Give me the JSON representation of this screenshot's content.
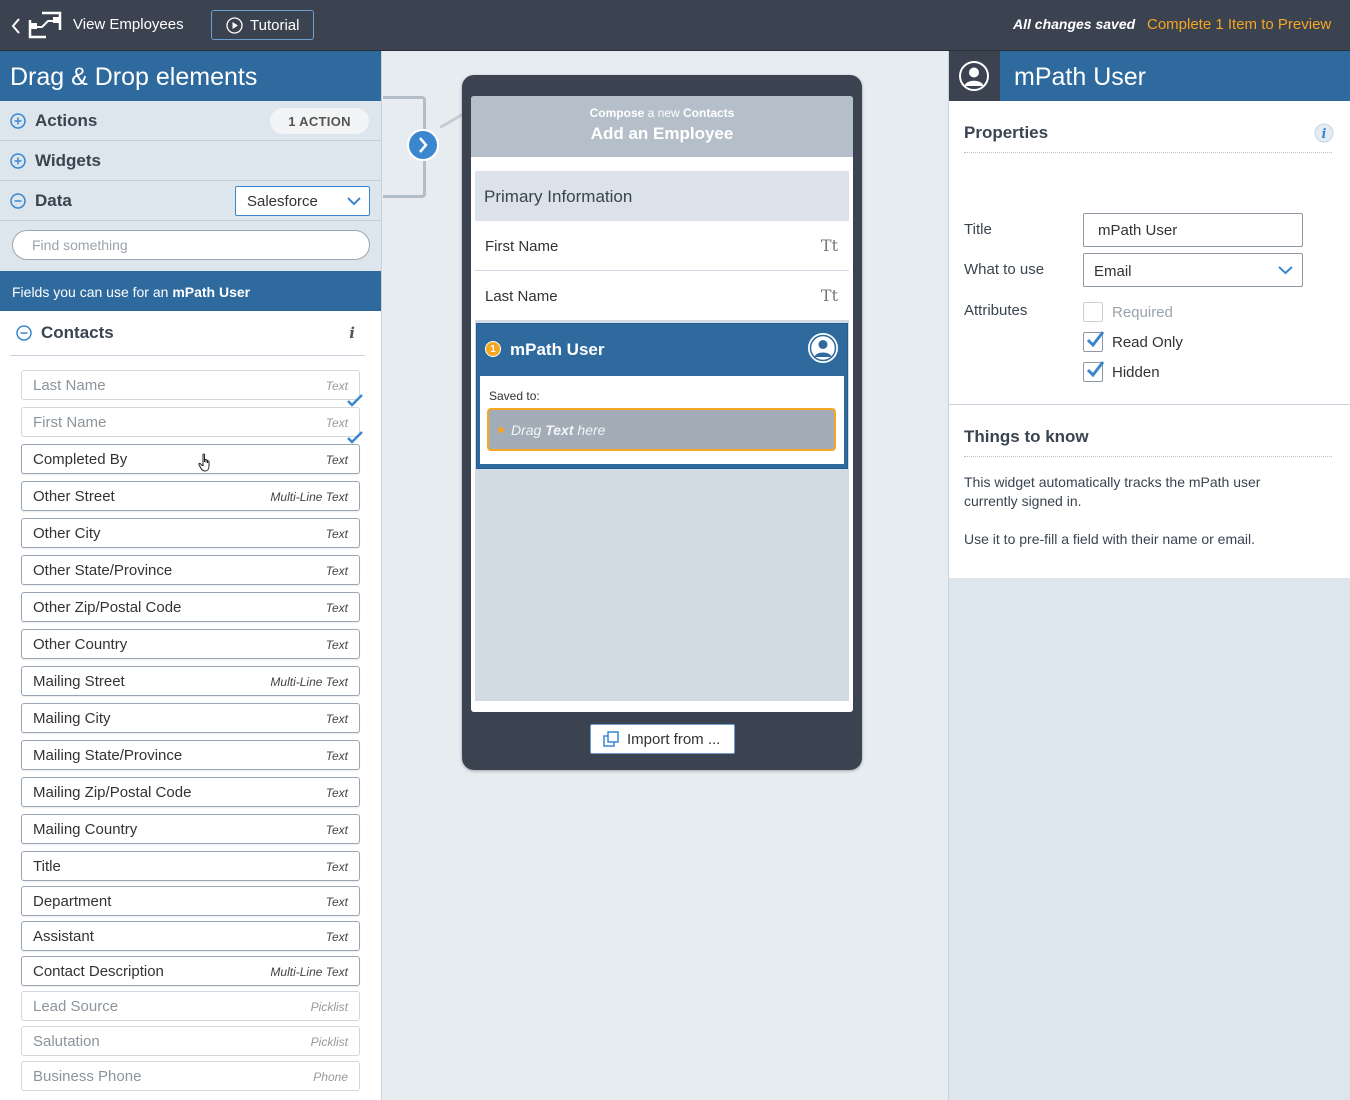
{
  "topbar": {
    "title": "View Employees",
    "tutorial_label": "Tutorial",
    "saved_status": "All changes saved",
    "preview_label": "Complete 1 Item to Preview",
    "colors": {
      "bar": "#3b4350",
      "accent": "#f5a623",
      "primary": "#2e6a9e"
    }
  },
  "left_panel": {
    "title": "Drag & Drop elements",
    "actions_label": "Actions",
    "actions_badge": "1 ACTION",
    "widgets_label": "Widgets",
    "data_label": "Data",
    "data_source": "Salesforce",
    "search_placeholder": "Find something",
    "fields_banner_prefix": "Fields you can use for an ",
    "fields_banner_object": "mPath User",
    "group_label": "Contacts",
    "info_glyph": "i",
    "fields": [
      {
        "label": "Last Name",
        "type": "Text",
        "state": "used"
      },
      {
        "label": "First Name",
        "type": "Text",
        "state": "used"
      },
      {
        "label": "Completed By",
        "type": "Text",
        "state": "available"
      },
      {
        "label": "Other Street",
        "type": "Multi-Line Text",
        "state": "available"
      },
      {
        "label": "Other City",
        "type": "Text",
        "state": "available"
      },
      {
        "label": "Other State/Province",
        "type": "Text",
        "state": "available"
      },
      {
        "label": "Other Zip/Postal Code",
        "type": "Text",
        "state": "available"
      },
      {
        "label": "Other Country",
        "type": "Text",
        "state": "available"
      },
      {
        "label": "Mailing Street",
        "type": "Multi-Line Text",
        "state": "available"
      },
      {
        "label": "Mailing City",
        "type": "Text",
        "state": "available"
      },
      {
        "label": "Mailing State/Province",
        "type": "Text",
        "state": "available"
      },
      {
        "label": "Mailing Zip/Postal Code",
        "type": "Text",
        "state": "available"
      },
      {
        "label": "Mailing Country",
        "type": "Text",
        "state": "available"
      },
      {
        "label": "Title",
        "type": "Text",
        "state": "available"
      },
      {
        "label": "Department",
        "type": "Text",
        "state": "available"
      },
      {
        "label": "Assistant",
        "type": "Text",
        "state": "available"
      },
      {
        "label": "Contact Description",
        "type": "Multi-Line Text",
        "state": "available"
      },
      {
        "label": "Lead Source",
        "type": "Picklist",
        "state": "incompatible"
      },
      {
        "label": "Salutation",
        "type": "Picklist",
        "state": "incompatible"
      },
      {
        "label": "Business Phone",
        "type": "Phone",
        "state": "incompatible"
      }
    ]
  },
  "canvas": {
    "compose_word": "Compose",
    "compose_mid": " a new ",
    "compose_object": "Contacts",
    "screen_title": "Add an Employee",
    "section_title": "Primary Information",
    "rows": [
      {
        "label": "First Name",
        "icon": "Tt"
      },
      {
        "label": "Last Name",
        "icon": "Tt"
      }
    ],
    "widget": {
      "badge": "1",
      "title": "mPath User",
      "saved_to": "Saved to:",
      "drop_pre": "Drag ",
      "drop_bold": "Text",
      "drop_post": " here"
    },
    "import_label": "Import from ..."
  },
  "right_panel": {
    "title": "mPath User",
    "properties_label": "Properties",
    "title_label": "Title",
    "title_value": "mPath User",
    "use_label": "What to use",
    "use_value": "Email",
    "attributes_label": "Attributes",
    "attributes": [
      {
        "label": "Required",
        "checked": false,
        "enabled": false
      },
      {
        "label": "Read Only",
        "checked": true,
        "enabled": true
      },
      {
        "label": "Hidden",
        "checked": true,
        "enabled": true
      }
    ],
    "things_label": "Things to know",
    "things_p1": "This widget automatically tracks the mPath user currently signed in.",
    "things_p2": "Use it to pre-fill a field with their name or email."
  }
}
